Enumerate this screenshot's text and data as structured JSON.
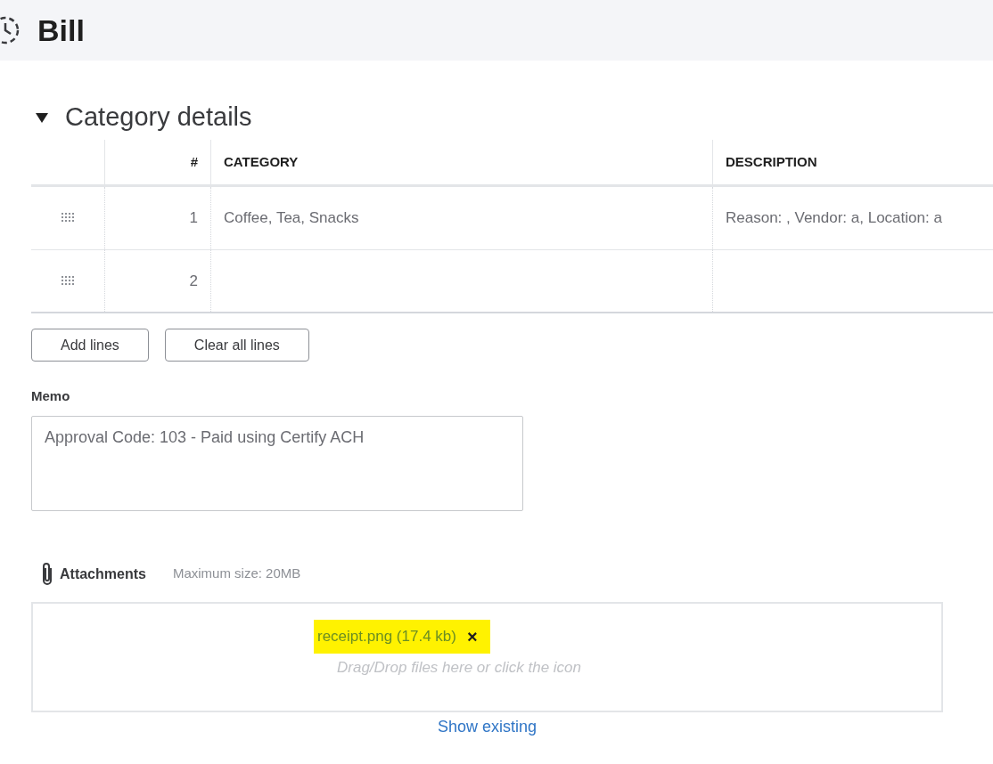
{
  "header": {
    "title": "Bill"
  },
  "section": {
    "title": "Category details",
    "expanded": true
  },
  "table": {
    "columns": [
      "#",
      "CATEGORY",
      "DESCRIPTION"
    ],
    "rows": [
      {
        "number": "1",
        "category": "Coffee, Tea, Snacks",
        "description": "Reason: , Vendor: a, Location: a"
      },
      {
        "number": "2",
        "category": "",
        "description": ""
      }
    ]
  },
  "buttons": [
    "Add lines",
    "Clear all lines"
  ],
  "memo": {
    "label": "Memo",
    "value": "Approval Code: 103 - Paid using Certify ACH"
  },
  "attachments": {
    "label": "Attachments",
    "max_size": "Maximum size: 20MB",
    "file": "receipt.png (17.4 kb)",
    "remove": "×",
    "hint": "Drag/Drop files here or click the icon",
    "show_existing": "Show existing"
  }
}
